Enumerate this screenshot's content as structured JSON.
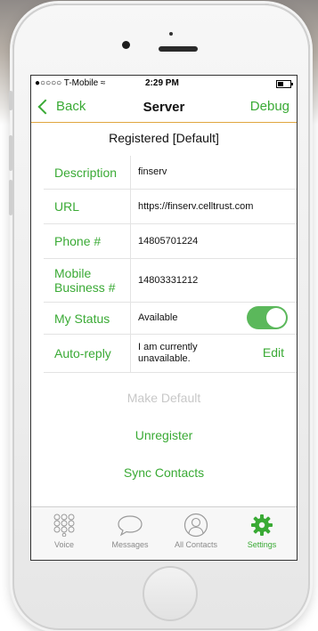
{
  "status": {
    "carrier": "●○○○○ T-Mobile ≈",
    "time": "2:29 PM"
  },
  "nav": {
    "back": "Back",
    "title": "Server",
    "debug": "Debug"
  },
  "header": "Registered [Default]",
  "fields": [
    {
      "label": "Description",
      "value": "finserv"
    },
    {
      "label": "URL",
      "value": "https://finserv.celltrust.com"
    },
    {
      "label": "Phone #",
      "value": "14805701224"
    },
    {
      "label": "Mobile Business #",
      "value": "14803331212"
    },
    {
      "label": "My Status",
      "value": "Available"
    },
    {
      "label": "Auto-reply",
      "value": "I am currently unavailable.",
      "action": "Edit"
    }
  ],
  "toggle_on": true,
  "actions": {
    "make_default": "Make Default",
    "unregister": "Unregister",
    "sync": "Sync Contacts"
  },
  "tabs": [
    {
      "label": "Voice",
      "icon": "keypad-icon"
    },
    {
      "label": "Messages",
      "icon": "chat-bubble-icon"
    },
    {
      "label": "All Contacts",
      "icon": "contact-icon"
    },
    {
      "label": "Settings",
      "icon": "gear-icon",
      "active": true
    }
  ],
  "colors": {
    "accent": "#3aaa35",
    "nav_border": "#e0a640",
    "disabled": "#c8c8c8"
  }
}
